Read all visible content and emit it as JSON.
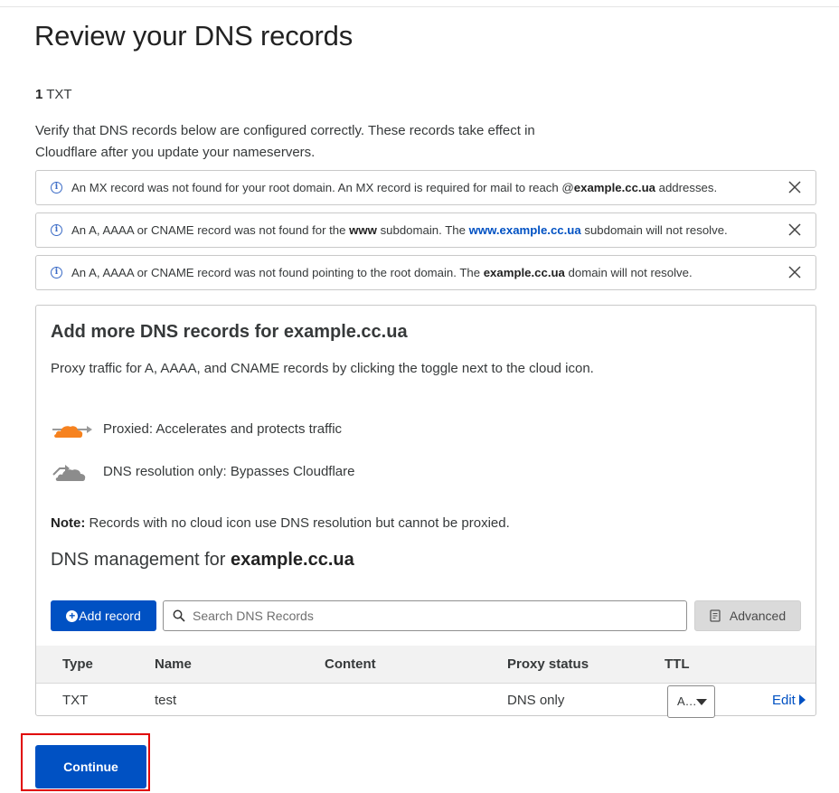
{
  "page": {
    "title": "Review your DNS records",
    "record_count": "1",
    "record_type": "TXT",
    "intro": "Verify that DNS records below are configured correctly. These records take effect in Cloudflare after you update your nameservers."
  },
  "alerts": [
    {
      "icon": "info-icon",
      "parts": [
        "An MX record was not found for your root domain. An MX record is required for mail to reach @",
        "example.cc.ua",
        " addresses."
      ],
      "close_icon": "close-icon"
    },
    {
      "icon": "info-icon",
      "parts": [
        "An A, AAAA or CNAME record was not found for the ",
        "www",
        " subdomain. The ",
        "www.example.cc.ua",
        " subdomain will not resolve."
      ],
      "close_icon": "close-icon"
    },
    {
      "icon": "info-icon",
      "parts": [
        "An A, AAAA or CNAME record was not found pointing to the root domain. The ",
        "example.cc.ua",
        " domain will not resolve."
      ],
      "close_icon": "close-icon"
    }
  ],
  "panel": {
    "title": "Add more DNS records for example.cc.ua",
    "description": "Proxy traffic for A, AAAA, and CNAME records by clicking the toggle next to the cloud icon.",
    "legend": [
      {
        "icon": "proxied-cloud-icon",
        "label": "Proxied: Accelerates and protects traffic"
      },
      {
        "icon": "dns-only-cloud-icon",
        "label": "DNS resolution only: Bypasses Cloudflare"
      }
    ],
    "note_label": "Note:",
    "note_text": " Records with no cloud icon use DNS resolution but cannot be proxied.",
    "mgmt_prefix": "DNS management for ",
    "mgmt_domain": "example.cc.ua"
  },
  "toolbar": {
    "add_record_label": "Add record",
    "search_placeholder": "Search DNS Records",
    "advanced_label": "Advanced"
  },
  "table": {
    "columns": [
      "Type",
      "Name",
      "Content",
      "Proxy status",
      "TTL"
    ],
    "rows": [
      {
        "type": "TXT",
        "name": "test",
        "content": "",
        "proxy_status": "DNS only",
        "ttl": "A…",
        "edit_label": "Edit"
      }
    ]
  },
  "footer": {
    "continue_label": "Continue"
  },
  "colors": {
    "accent": "#0051c3",
    "proxied_orange": "#f6821f",
    "highlight_red": "#e00000"
  }
}
